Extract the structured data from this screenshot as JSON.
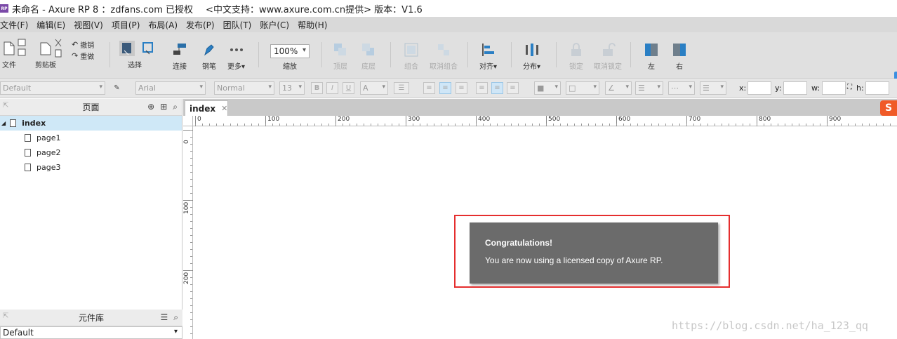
{
  "window": {
    "title": "未命名 - Axure RP 8 ：zdfans.com 已授权",
    "title_extra": "<中文支持：www.axure.com.cn提供> 版本：V1.6",
    "logo_text": "RP"
  },
  "menu": [
    "文件(F)",
    "编辑(E)",
    "视图(V)",
    "项目(P)",
    "布局(A)",
    "发布(P)",
    "团队(T)",
    "账户(C)",
    "帮助(H)"
  ],
  "toolbar": {
    "file": "文件",
    "clipboard": "剪贴板",
    "undo": "撤销",
    "redo": "重做",
    "select": "选择",
    "connect": "连接",
    "pen": "钢笔",
    "more": "更多▾",
    "zoom_value": "100%",
    "zoom_label": "缩放",
    "top": "顶层",
    "bottom": "底层",
    "group": "组合",
    "ungroup": "取消组合",
    "align": "对齐▾",
    "distribute": "分布▾",
    "lock": "锁定",
    "unlock": "取消锁定",
    "left": "左",
    "right": "右"
  },
  "format": {
    "style": "Default",
    "font": "Arial",
    "weight": "Normal",
    "size": "13",
    "bold": "B",
    "italic": "I",
    "underline": "U",
    "x_label": "x:",
    "y_label": "y:",
    "w_label": "w:",
    "h_label": "h:"
  },
  "pages_panel": {
    "title": "页面",
    "root": "index",
    "children": [
      "page1",
      "page2",
      "page3"
    ]
  },
  "widgets_panel": {
    "title": "元件库",
    "library": "Default"
  },
  "tab": {
    "label": "index",
    "close": "✕"
  },
  "ruler": {
    "h_labels": [
      "0",
      "100",
      "200",
      "300",
      "400",
      "500",
      "600",
      "700",
      "800",
      "900"
    ],
    "v_labels": [
      "0",
      "100",
      "200"
    ]
  },
  "dialog": {
    "title": "Congratulations!",
    "message": "You are now using a licensed copy of Axure RP."
  },
  "watermark": "https://blog.csdn.net/ha_123_qq",
  "colors": {
    "accent": "#3b8fe0",
    "highlight_border": "#e52e2e",
    "dialog_bg": "#6b6b6b",
    "selected_row": "#cfe8f7"
  }
}
